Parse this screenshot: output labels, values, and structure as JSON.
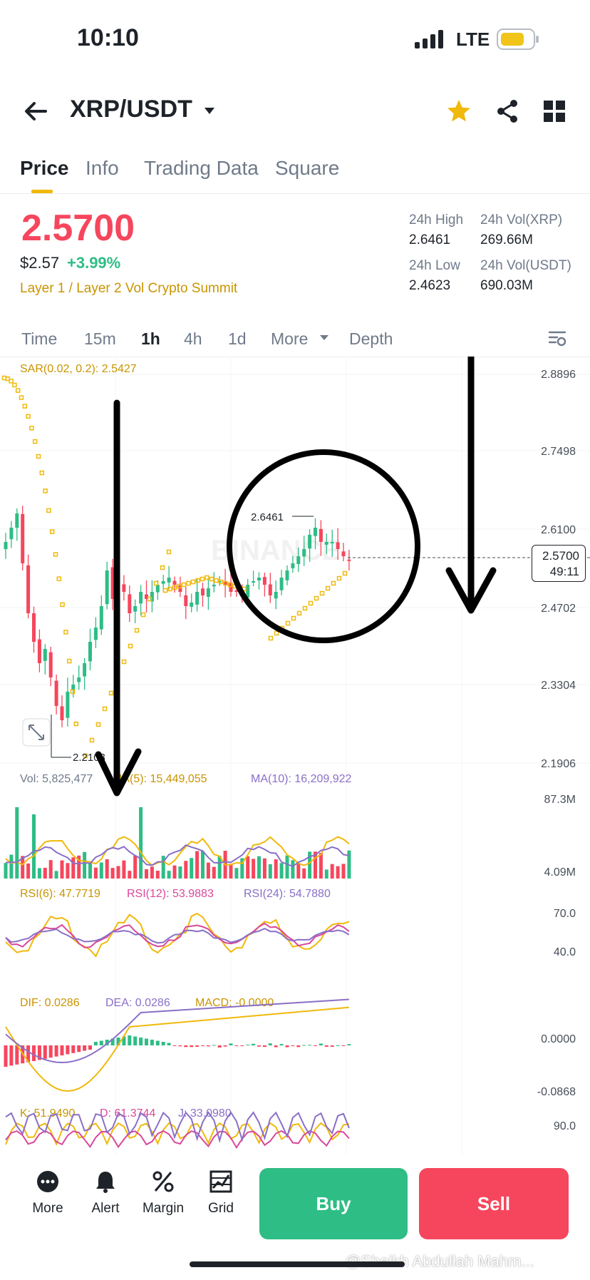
{
  "status_bar": {
    "time": "10:10",
    "network": "LTE"
  },
  "header": {
    "pair": "XRP/USDT"
  },
  "tabs": [
    {
      "label": "Price"
    },
    {
      "label": "Info"
    },
    {
      "label": "Trading Data"
    },
    {
      "label": "Square"
    }
  ],
  "price": {
    "last": "2.5700",
    "usd": "$2.57",
    "change": "+3.99%",
    "tags": "Layer 1 / Layer 2   Vol   Crypto Summit"
  },
  "stats": {
    "high_label": "24h High",
    "high_value": "2.6461",
    "low_label": "24h Low",
    "low_value": "2.4623",
    "vol_xrp_label": "24h Vol(XRP)",
    "vol_xrp_value": "269.66M",
    "vol_usdt_label": "24h Vol(USDT)",
    "vol_usdt_value": "690.03M"
  },
  "intervals": {
    "time": "Time",
    "m15": "15m",
    "h1": "1h",
    "h4": "4h",
    "d1": "1d",
    "more": "More",
    "depth": "Depth"
  },
  "chart": {
    "sar": "SAR(0.02, 0.2): 2.5427",
    "price_axis": [
      "2.8896",
      "2.7498",
      "2.6100",
      "2.4702",
      "2.3304",
      "2.1906"
    ],
    "high_marker": "2.6461",
    "low_marker": "2.2103",
    "current_price": "2.5700",
    "countdown": "49:11",
    "watermark": "BINANCE"
  },
  "volume": {
    "vol": "Vol: 5,825,477",
    "ma5": "MA(5): 15,449,055",
    "ma10": "MA(10): 16,209,922",
    "axis_top": "87.3M",
    "axis_bottom": "4.09M"
  },
  "rsi": {
    "rsi6": "RSI(6): 47.7719",
    "rsi12": "RSI(12): 53.9883",
    "rsi24": "RSI(24): 54.7880",
    "axis_top": "70.0",
    "axis_bottom": "40.0"
  },
  "macd": {
    "dif": "DIF: 0.0286",
    "dea": "DEA: 0.0286",
    "macd": "MACD: -0.0000",
    "axis_top": "0.0000",
    "axis_bottom": "-0.0868"
  },
  "kdj": {
    "k": "K: 51.9490",
    "d": "D: 61.3744",
    "j": "J: 33.0980",
    "axis_top": "90.0"
  },
  "bottom_bar": {
    "more": "More",
    "alert": "Alert",
    "margin": "Margin",
    "grid": "Grid",
    "buy": "Buy",
    "sell": "Sell"
  },
  "overlay_watermark": "@Sheikh Abdullah Mahm...",
  "colors": {
    "up": "#2ebd85",
    "down": "#f6465d",
    "accent": "#f0b90b",
    "ma10": "#8a6fc7",
    "rsi12": "#d9489b"
  }
}
